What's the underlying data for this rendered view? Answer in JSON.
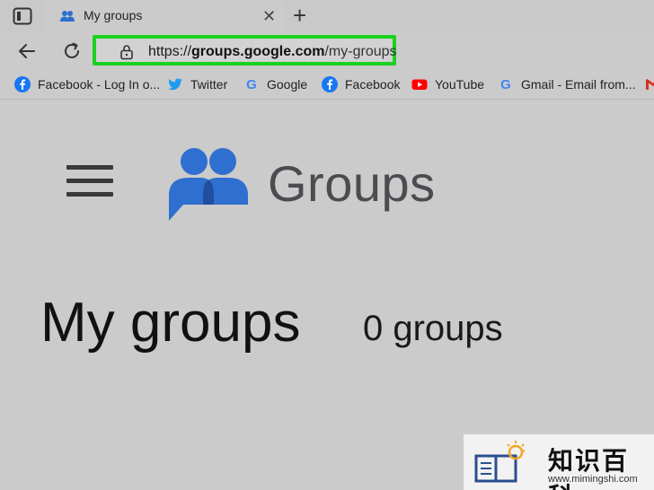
{
  "tabs": [
    {
      "title": "My groups"
    }
  ],
  "toolbar": {
    "url_scheme": "https://",
    "url_host": "groups.google.com",
    "url_path": "/my-groups"
  },
  "bookmarks": [
    {
      "label": "Facebook - Log In o...",
      "icon": "facebook-icon"
    },
    {
      "label": "Twitter",
      "icon": "twitter-icon"
    },
    {
      "label": "Google",
      "icon": "google-icon"
    },
    {
      "label": "Facebook",
      "icon": "facebook-icon"
    },
    {
      "label": "YouTube",
      "icon": "youtube-icon"
    },
    {
      "label": "Gmail - Email from...",
      "icon": "google-icon"
    }
  ],
  "page": {
    "brand": "Groups",
    "heading": "My groups",
    "group_count": "0 groups"
  },
  "watermark": {
    "text": "知识百科",
    "url": "www.mimingshi.com"
  },
  "colors": {
    "highlight": "#19d11f",
    "brand_blue": "#2f6fd0",
    "background": "#cbcbcb"
  }
}
